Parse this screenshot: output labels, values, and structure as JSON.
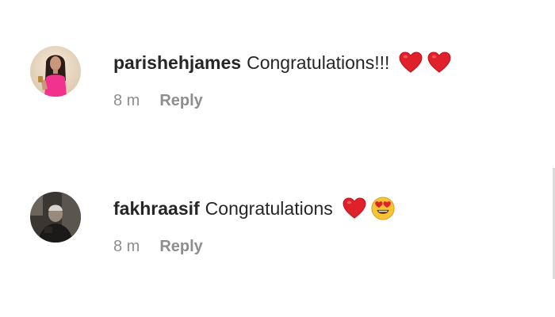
{
  "comments": [
    {
      "username": "parishehjames",
      "text": "Congratulations!!!",
      "emojis": [
        "red-heart",
        "red-heart"
      ],
      "time": "8 m",
      "reply_label": "Reply"
    },
    {
      "username": "fakhraasif",
      "text": "Congratulations",
      "emojis": [
        "red-heart",
        "heart-eyes-face"
      ],
      "time": "8 m",
      "reply_label": "Reply"
    }
  ],
  "colors": {
    "text": "#262626",
    "meta": "#8e8e8e",
    "heart": "#e0202a",
    "background": "#ffffff"
  }
}
